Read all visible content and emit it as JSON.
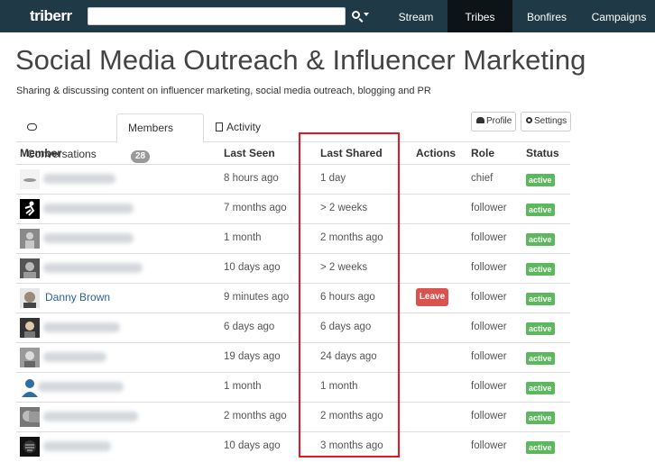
{
  "nav": {
    "logo": "triberr",
    "search_value": "",
    "items": [
      "Stream",
      "Tribes",
      "Bonfires",
      "Campaigns"
    ]
  },
  "page": {
    "title": "Social Media Outreach & Influencer Marketing",
    "subtitle": "Sharing & discussing content on influencer marketing, social media outreach, blogging and PR"
  },
  "tabs": {
    "conversations": "Conversations",
    "members": "Members",
    "members_count": "28",
    "activity": "Activity"
  },
  "buttons": {
    "profile": "Profile",
    "settings": "Settings"
  },
  "table": {
    "headers": [
      "Member",
      "Last Seen",
      "Last Shared",
      "Actions",
      "Role",
      "Status"
    ],
    "rows": [
      {
        "name": "",
        "last_seen": "8 hours ago",
        "last_shared": "1 day",
        "action": "",
        "role": "chief",
        "status": "active"
      },
      {
        "name": "",
        "last_seen": "7 months ago",
        "last_shared": "> 2 weeks",
        "action": "",
        "role": "follower",
        "status": "active"
      },
      {
        "name": "",
        "last_seen": "1 month",
        "last_shared": "2 months ago",
        "action": "",
        "role": "follower",
        "status": "active"
      },
      {
        "name": "",
        "last_seen": "10 days ago",
        "last_shared": "> 2 weeks",
        "action": "",
        "role": "follower",
        "status": "active"
      },
      {
        "name": "Danny Brown",
        "last_seen": "9 minutes ago",
        "last_shared": "6 hours ago",
        "action": "Leave",
        "role": "follower",
        "status": "active"
      },
      {
        "name": "",
        "last_seen": "6 days ago",
        "last_shared": "6 days ago",
        "action": "",
        "role": "follower",
        "status": "active"
      },
      {
        "name": "",
        "last_seen": "19 days ago",
        "last_shared": "24 days ago",
        "action": "",
        "role": "follower",
        "status": "active"
      },
      {
        "name": "",
        "last_seen": "1 month",
        "last_shared": "1 month",
        "action": "",
        "role": "follower",
        "status": "active"
      },
      {
        "name": "",
        "last_seen": "2 months ago",
        "last_shared": "2 months ago",
        "action": "",
        "role": "follower",
        "status": "active"
      },
      {
        "name": "",
        "last_seen": "10 days ago",
        "last_shared": "3 months ago",
        "action": "",
        "role": "follower",
        "status": "active"
      }
    ]
  },
  "colors": {
    "navbar": "#1f3a46",
    "active_badge": "#5cb85c",
    "leave_button": "#d9534f",
    "highlight": "#e8171f",
    "link": "#2a6496"
  }
}
